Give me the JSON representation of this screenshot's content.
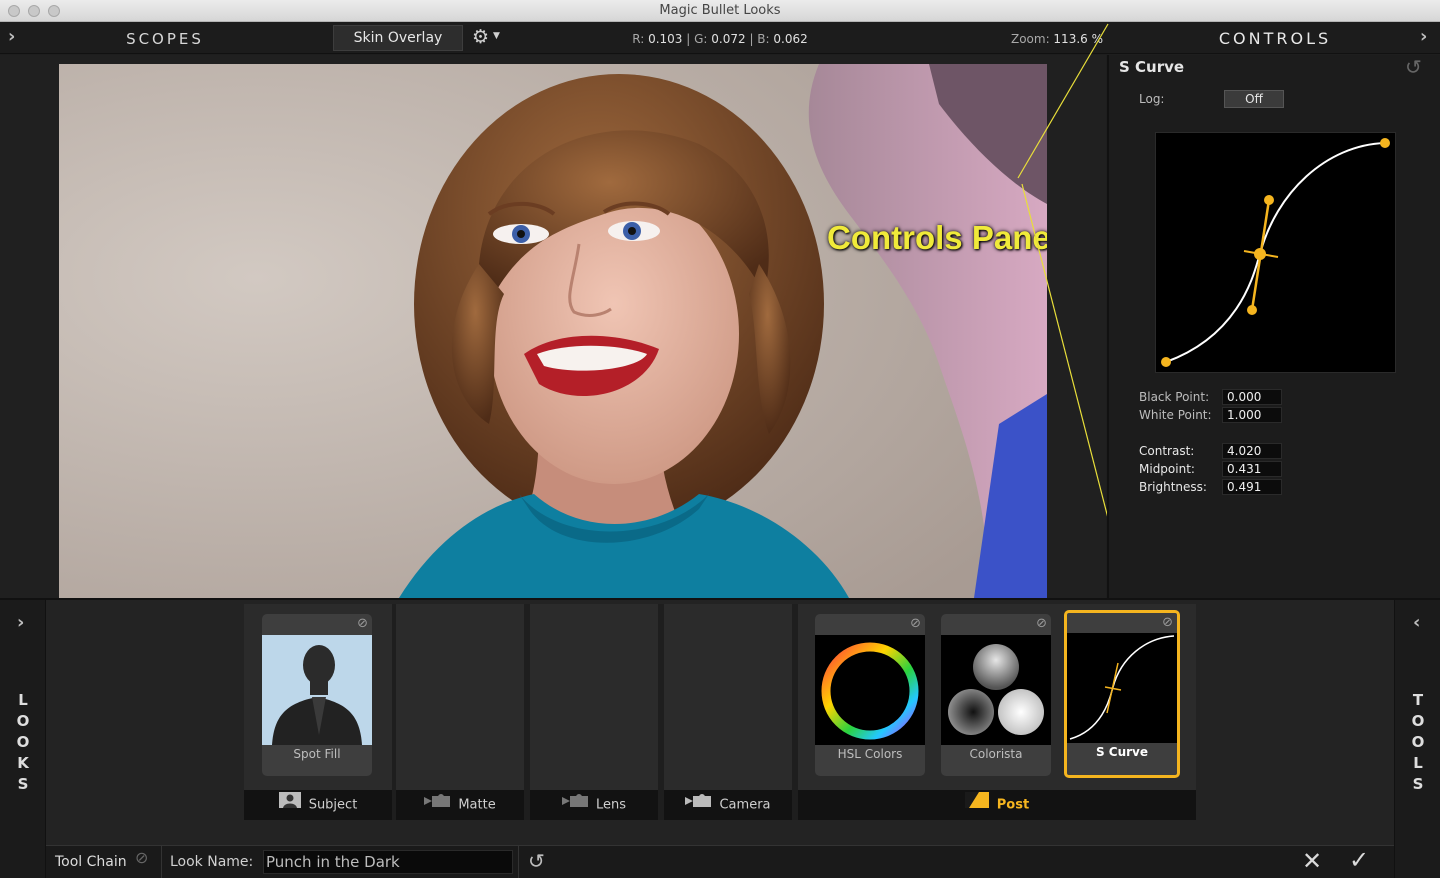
{
  "window": {
    "title": "Magic Bullet Looks"
  },
  "header": {
    "scopes_title": "SCOPES",
    "overlay_button": "Skin Overlay",
    "readout_r": "0.103",
    "readout_g": "0.072",
    "readout_b": "0.062",
    "zoom": "113.6 %",
    "controls_title": "CONTROLS"
  },
  "viewer": {
    "callout": "Controls Panel"
  },
  "controls": {
    "tool_name": "S Curve",
    "log_label": "Log:",
    "log_value": "Off",
    "black_point_label": "Black Point:",
    "black_point": "0.000",
    "white_point_label": "White Point:",
    "white_point": "1.000",
    "contrast_label": "Contrast:",
    "contrast": "4.020",
    "midpoint_label": "Midpoint:",
    "midpoint": "0.431",
    "brightness_label": "Brightness:",
    "brightness": "0.491"
  },
  "tool_chain": {
    "cards": [
      {
        "name": "Spot Fill",
        "icon": "silhouette-thumb"
      },
      {
        "name": "HSL Colors",
        "icon": "color-wheel-thumb"
      },
      {
        "name": "Colorista",
        "icon": "three-balls-thumb"
      },
      {
        "name": "S Curve",
        "icon": "curve-thumb",
        "selected": true
      }
    ],
    "categories": [
      {
        "label": "Subject",
        "icon": "subject-icon"
      },
      {
        "label": "Matte",
        "icon": "camera-icon"
      },
      {
        "label": "Lens",
        "icon": "camera-icon"
      },
      {
        "label": "Camera",
        "icon": "camera-icon"
      },
      {
        "label": "Post",
        "icon": "post-icon",
        "active": true
      }
    ]
  },
  "sides": {
    "looks": "LOOKS",
    "tools": "TOOLS"
  },
  "footer": {
    "tool_chain_label": "Tool Chain",
    "look_name_label": "Look Name:",
    "look_name_value": "Punch in the Dark"
  },
  "colors": {
    "accent": "#f5b51f",
    "callout": "#f0ea3a"
  }
}
